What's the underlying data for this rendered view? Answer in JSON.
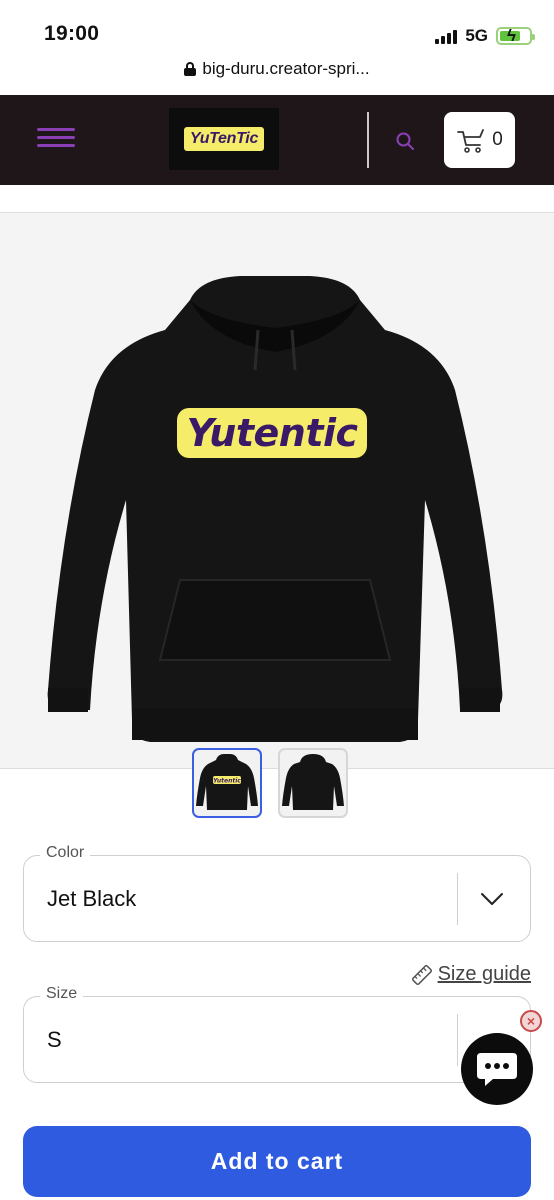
{
  "status_bar": {
    "time": "19:00",
    "network": "5G",
    "battery_charging": true
  },
  "browser": {
    "url": "big-duru.creator-spri..."
  },
  "header": {
    "logo_text": "YuTenTic",
    "cart_count": "0",
    "accent_color": "#8a3fb4",
    "background_color": "#1f1619"
  },
  "product": {
    "print_text": "Yutentic",
    "thumbnails": [
      {
        "view": "front",
        "selected": true,
        "print_text": "Yutentic"
      },
      {
        "view": "back",
        "selected": false
      }
    ]
  },
  "color_select": {
    "label": "Color",
    "value": "Jet Black"
  },
  "size_guide": {
    "label": "Size guide"
  },
  "size_select": {
    "label": "Size",
    "value": "S"
  },
  "chat": {
    "close_symbol": "×"
  },
  "cta": {
    "add_to_cart": "Add to cart",
    "color": "#2f5be0"
  }
}
